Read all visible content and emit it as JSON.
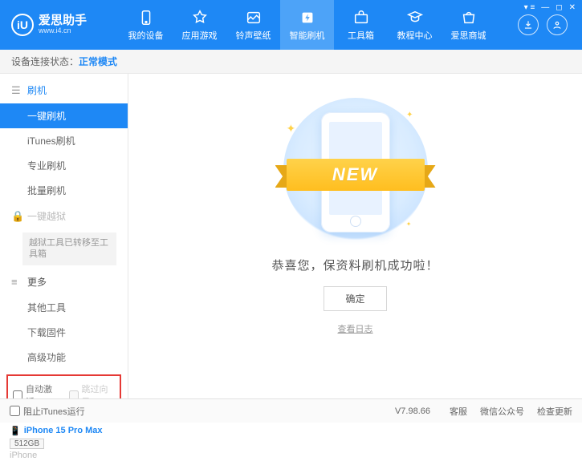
{
  "header": {
    "logo_letter": "iU",
    "title": "爱思助手",
    "subtitle": "www.i4.cn",
    "nav": [
      {
        "label": "我的设备"
      },
      {
        "label": "应用游戏"
      },
      {
        "label": "铃声壁纸"
      },
      {
        "label": "智能刷机"
      },
      {
        "label": "工具箱"
      },
      {
        "label": "教程中心"
      },
      {
        "label": "爱思商城"
      }
    ]
  },
  "status": {
    "prefix": "设备连接状态：",
    "mode": "正常模式"
  },
  "sidebar": {
    "sections": {
      "flash": {
        "title": "刷机",
        "items": [
          "一键刷机",
          "iTunes刷机",
          "专业刷机",
          "批量刷机"
        ]
      },
      "jailbreak": {
        "title": "一键越狱",
        "note": "越狱工具已转移至工具箱"
      },
      "more": {
        "title": "更多",
        "items": [
          "其他工具",
          "下载固件",
          "高级功能"
        ]
      }
    },
    "checks": {
      "auto_activate": "自动激活",
      "skip_setup": "跳过向导"
    }
  },
  "device": {
    "name": "iPhone 15 Pro Max",
    "storage": "512GB",
    "platform": "iPhone"
  },
  "main": {
    "ribbon": "NEW",
    "success": "恭喜您，保资料刷机成功啦！",
    "ok": "确定",
    "view_log": "查看日志"
  },
  "bottom": {
    "block_itunes": "阻止iTunes运行",
    "version": "V7.98.66",
    "links": [
      "客服",
      "微信公众号",
      "检查更新"
    ]
  }
}
